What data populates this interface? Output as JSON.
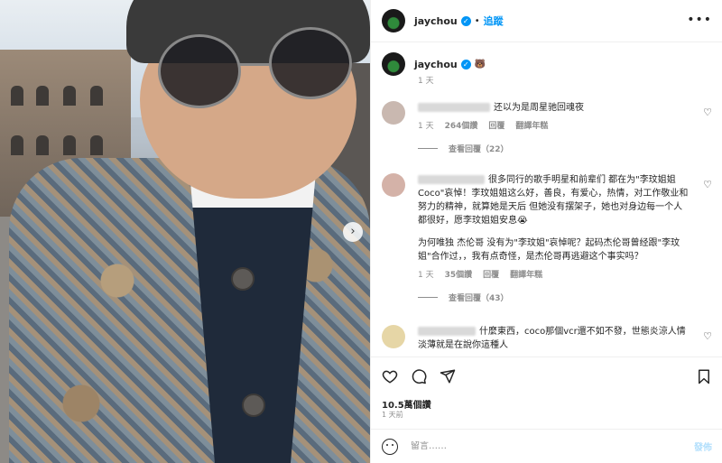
{
  "header": {
    "username": "jaychou",
    "follow_label": "追蹤",
    "dot": "•",
    "more": "•••"
  },
  "caption": {
    "username": "jaychou",
    "bear": "🐻",
    "time": "1 天"
  },
  "comments": [
    {
      "text": "还以为是周星驰回魂夜",
      "time": "1 天",
      "likes": "264個讚",
      "reply": "回覆",
      "translate": "翻譯年糕",
      "view_replies": "查看回覆（22）"
    },
    {
      "text": "很多同行的歌手明星和前辈们 都在为\"李玟姐姐Coco\"哀悼！李玟姐姐这么好，善良，有爱心，热情，对工作敬业和努力的精神，就算她是天后 但她没有摆架子，她也对身边每一个人都很好，愿李玟姐姐安息😭",
      "text2": "为何唯独 杰伦哥 没有为\"李玟姐\"哀悼呢？起码杰伦哥曾经跟\"李玟姐\"合作过，，我有点奇怪，是杰伦哥再逃避这个事实吗？",
      "time": "1 天",
      "likes": "35個讚",
      "reply": "回覆",
      "translate": "翻譯年糕",
      "view_replies": "查看回覆（43）"
    },
    {
      "text": "什麼東西，coco那個vcr還不如不發，世態炎涼人情淡薄就是在說你這種人"
    }
  ],
  "stats": {
    "likes": "10.5萬個讚",
    "date": "1 天前"
  },
  "add_comment": {
    "placeholder": "留言……",
    "post_label": "發佈"
  },
  "colors": {
    "accent": "#0095f6",
    "muted": "#8e8e8e",
    "post_disabled": "#b2dffc"
  },
  "icons": [
    "heart-icon",
    "comment-icon",
    "share-icon",
    "bookmark-icon",
    "emoji-icon",
    "more-icon",
    "verified-icon",
    "chevron-right-icon"
  ]
}
